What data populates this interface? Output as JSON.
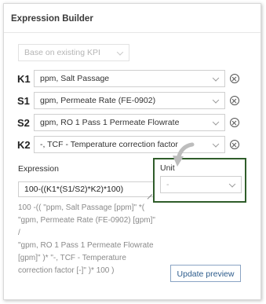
{
  "panel": {
    "title": "Expression Builder"
  },
  "base_kpi": {
    "placeholder": "Base on existing KPI"
  },
  "variables": [
    {
      "label": "K1",
      "value": "ppm, Salt Passage"
    },
    {
      "label": "S1",
      "value": "gpm, Permeate Rate (FE-0902)"
    },
    {
      "label": "S2",
      "value": "gpm, RO 1 Pass 1 Permeate Flowrate"
    },
    {
      "label": "K2",
      "value": "-, TCF - Temperature correction factor"
    }
  ],
  "expression": {
    "label": "Expression",
    "value": "100-((K1*(S1/S2)*K2)*100)",
    "preview_lines": [
      "100 -(( \"ppm, Salt Passage [ppm]\" *(",
      "\"gpm, Permeate Rate (FE-0902) [gpm]\" /",
      "\"gpm, RO 1 Pass 1 Permeate Flowrate",
      "[gpm]\" )* \"-, TCF - Temperature",
      "correction factor [-]\" )* 100 )"
    ]
  },
  "unit": {
    "label": "Unit",
    "value": "-"
  },
  "actions": {
    "update_preview": "Update preview"
  },
  "colors": {
    "highlight_border": "#2f5d2a",
    "button_text": "#2d5c8c"
  }
}
